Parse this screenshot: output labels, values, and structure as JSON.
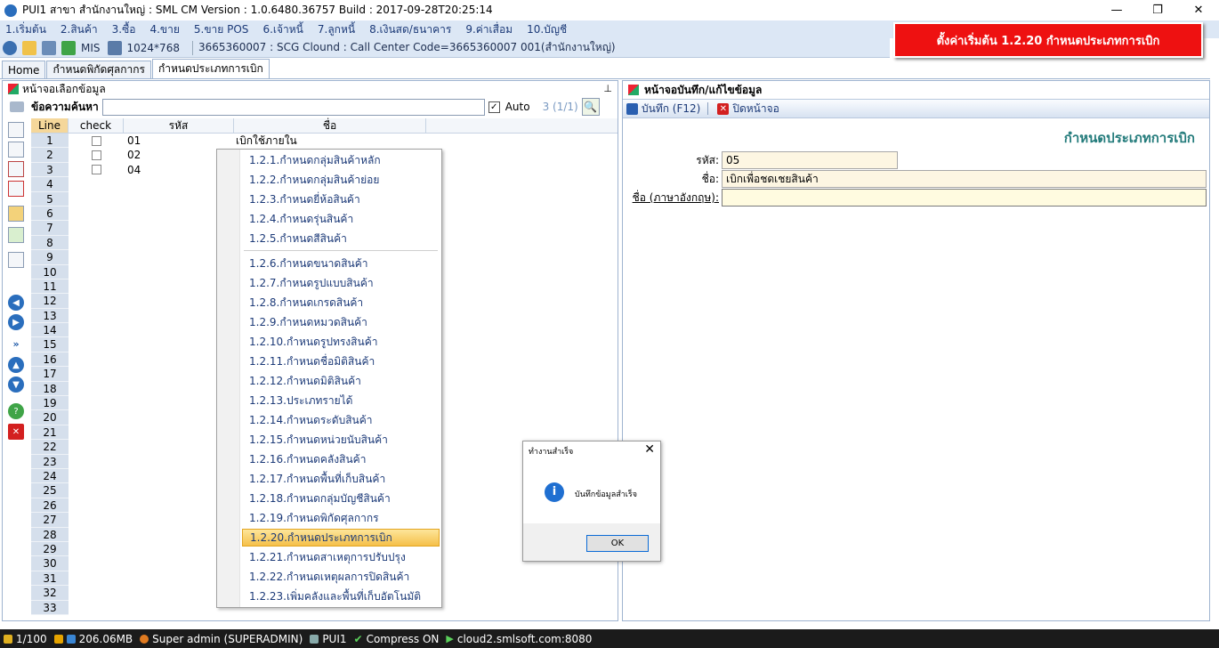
{
  "window": {
    "title": "PUI1 สาขา สำนักงานใหญ่ : SML CM Version : 1.0.6480.36757  Build : 2017-09-28T20:25:14",
    "minimize": "—",
    "restore": "❐",
    "close": "✕"
  },
  "menu": [
    "1.เริ่มต้น",
    "2.สินค้า",
    "3.ซื้อ",
    "4.ขาย",
    "5.ขาย POS",
    "6.เจ้าหนี้",
    "7.ลูกหนี้",
    "8.เงินสด/ธนาคาร",
    "9.ค่าเสื่อม",
    "10.บัญชี"
  ],
  "toolbar": {
    "mis": "MIS",
    "resolution": "1024*768",
    "info": "3665360007 : SCG Clound : Call Center Code=3665360007 001(สำนักงานใหญ่)"
  },
  "banner": "ตั้งค่าเริ่มต้น 1.2.20 กำหนดประเภทการเบิก",
  "tabs": [
    "Home",
    "กำหนดพิกัดศุลกากร",
    "กำหนดประเภทการเบิก"
  ],
  "left_pane": {
    "title": "หน้าจอเลือกข้อมูล",
    "pin": "⊥",
    "search_label": "ข้อความค้นหา",
    "search_value": "",
    "auto_checked": "✓",
    "auto_label": "Auto",
    "count": "3 (1/1)",
    "search_button": "🔍"
  },
  "grid": {
    "columns": [
      "Line",
      "check",
      "รหัส",
      "ชื่อ"
    ],
    "rows": [
      {
        "line": "1",
        "code": "01",
        "name": "เบิกใช้ภายใน"
      },
      {
        "line": "2",
        "code": "02",
        "name": ""
      },
      {
        "line": "3",
        "code": "04",
        "name": ""
      },
      {
        "line": "4",
        "code": "",
        "name": ""
      },
      {
        "line": "5",
        "code": "",
        "name": ""
      },
      {
        "line": "6",
        "code": "",
        "name": ""
      },
      {
        "line": "7",
        "code": "",
        "name": ""
      },
      {
        "line": "8",
        "code": "",
        "name": ""
      },
      {
        "line": "9",
        "code": "",
        "name": ""
      },
      {
        "line": "10",
        "code": "",
        "name": ""
      },
      {
        "line": "11",
        "code": "",
        "name": ""
      },
      {
        "line": "12",
        "code": "",
        "name": ""
      },
      {
        "line": "13",
        "code": "",
        "name": ""
      },
      {
        "line": "14",
        "code": "",
        "name": ""
      },
      {
        "line": "15",
        "code": "",
        "name": ""
      },
      {
        "line": "16",
        "code": "",
        "name": ""
      },
      {
        "line": "17",
        "code": "",
        "name": ""
      },
      {
        "line": "18",
        "code": "",
        "name": ""
      },
      {
        "line": "19",
        "code": "",
        "name": ""
      },
      {
        "line": "20",
        "code": "",
        "name": ""
      },
      {
        "line": "21",
        "code": "",
        "name": ""
      },
      {
        "line": "22",
        "code": "",
        "name": ""
      },
      {
        "line": "23",
        "code": "",
        "name": ""
      },
      {
        "line": "24",
        "code": "",
        "name": ""
      },
      {
        "line": "25",
        "code": "",
        "name": ""
      },
      {
        "line": "26",
        "code": "",
        "name": ""
      },
      {
        "line": "27",
        "code": "",
        "name": ""
      },
      {
        "line": "28",
        "code": "",
        "name": ""
      },
      {
        "line": "29",
        "code": "",
        "name": ""
      },
      {
        "line": "30",
        "code": "",
        "name": ""
      },
      {
        "line": "31",
        "code": "",
        "name": ""
      },
      {
        "line": "32",
        "code": "",
        "name": ""
      },
      {
        "line": "33",
        "code": "",
        "name": ""
      }
    ]
  },
  "context_menu": {
    "items": [
      "1.2.1.กำหนดกลุ่มสินค้าหลัก",
      "1.2.2.กำหนดกลุ่มสินค้าย่อย",
      "1.2.3.กำหนดยี่ห้อสินค้า",
      "1.2.4.กำหนดรุ่นสินค้า",
      "1.2.5.กำหนดสีสินค้า",
      "1.2.6.กำหนดขนาดสินค้า",
      "1.2.7.กำหนดรูปแบบสินค้า",
      "1.2.8.กำหนดเกรดสินค้า",
      "1.2.9.กำหนดหมวดสินค้า",
      "1.2.10.กำหนดรูปทรงสินค้า",
      "1.2.11.กำหนดชื่อมิติสินค้า",
      "1.2.12.กำหนดมิติสินค้า",
      "1.2.13.ประเภทรายได้",
      "1.2.14.กำหนดระดับสินค้า",
      "1.2.15.กำหนดหน่วยนับสินค้า",
      "1.2.16.กำหนดคลังสินค้า",
      "1.2.17.กำหนดพื้นที่เก็บสินค้า",
      "1.2.18.กำหนดกลุ่มบัญชีสินค้า",
      "1.2.19.กำหนดพิกัดศุลกากร",
      "1.2.20.กำหนดประเภทการเบิก",
      "1.2.21.กำหนดสาเหตุการปรับปรุง",
      "1.2.22.กำหนดเหตุผลการปิดสินค้า",
      "1.2.23.เพิ่มคลังและพื้นที่เก็บอัตโนมัติ"
    ],
    "highlighted_index": 19
  },
  "right_pane": {
    "title": "หน้าจอบันทึก/แก้ไขข้อมูล",
    "save_label": "บันทึก (F12)",
    "close_label": "ปิดหน้าจอ",
    "heading": "กำหนดประเภทการเบิก",
    "code_label": "รหัส:",
    "code_value": "05",
    "name_label": "ชื่อ:",
    "name_value": "เบิกเพื่อชดเชยสินค้า",
    "name_en_label": "ชื่อ (ภาษาอังกฤษ):",
    "name_en_value": ""
  },
  "dialog": {
    "title": "ทำงานสำเร็จ",
    "close": "✕",
    "icon": "i",
    "message": "บันทึกข้อมูลสำเร็จ",
    "ok": "OK"
  },
  "statusbar": {
    "page": "1/100",
    "memory": "206.06MB",
    "user": "Super admin (SUPERADMIN)",
    "branch": "PUI1",
    "compress": "Compress ON",
    "server": "cloud2.smlsoft.com:8080"
  }
}
